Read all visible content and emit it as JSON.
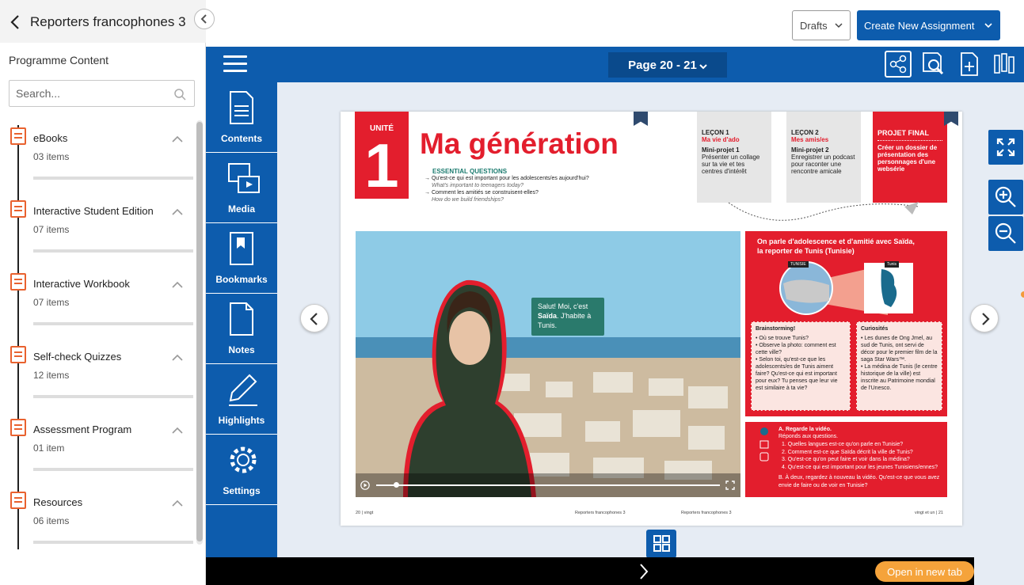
{
  "sidebar": {
    "book_title": "Reporters francophones 3",
    "programme_label": "Programme Content",
    "search_placeholder": "Search...",
    "sections": [
      {
        "name": "eBooks",
        "count": "03 items"
      },
      {
        "name": "Interactive Student Edition",
        "count": "07 items"
      },
      {
        "name": "Interactive Workbook",
        "count": "07 items"
      },
      {
        "name": "Self-check Quizzes",
        "count": "12 items"
      },
      {
        "name": "Assessment Program",
        "count": "01 item"
      },
      {
        "name": "Resources",
        "count": "06 items"
      }
    ]
  },
  "header": {
    "drafts_label": "Drafts",
    "create_label": "Create New Assignment"
  },
  "viewer": {
    "page_selector": "Page 20 - 21",
    "rail": [
      {
        "label": "Contents",
        "icon": "contents-icon"
      },
      {
        "label": "Media",
        "icon": "media-icon"
      },
      {
        "label": "Bookmarks",
        "icon": "bookmark-icon"
      },
      {
        "label": "Notes",
        "icon": "notes-icon"
      },
      {
        "label": "Highlights",
        "icon": "highlight-icon"
      },
      {
        "label": "Settings",
        "icon": "gear-icon"
      }
    ],
    "open_new_tab": "Open in new tab",
    "accent_color": "#0d5cad"
  },
  "page": {
    "unit_label": "UNITÉ",
    "unit_number": "1",
    "title": "Ma génération",
    "essential_questions_title": "ESSENTIAL QUESTIONS",
    "q1": "Qu'est-ce qui est important pour les adolescents/es aujourd'hui?",
    "q1_en": "What's important to teenagers today?",
    "q2": "Comment les amitiés se construisent-elles?",
    "q2_en": "How do we build friendships?",
    "lecon1": {
      "head": "LEÇON 1",
      "sub": "Ma vie d'ado",
      "proj": "Mini-projet 1",
      "desc": "Présenter un collage sur ta vie et tes centres d'intérêt"
    },
    "lecon2": {
      "head": "LEÇON 2",
      "sub": "Mes amis/es",
      "proj": "Mini-projet 2",
      "desc": "Enregistrer un podcast pour raconter une rencontre amicale"
    },
    "projet": {
      "head": "PROJET FINAL",
      "desc": "Créer un dossier de présentation des personnages d'une websérie"
    },
    "bubble_1": "Salut! Moi, c'est",
    "bubble_name": "Saïda",
    "bubble_2": ". J'habite à Tunis.",
    "red_heading_1": "On parle d'adolescence et d'amitié avec Saïda,",
    "red_heading_2": "la reporter de ",
    "red_heading_place": "Tunis (Tunisie)",
    "map_label_1": "TUNISIE",
    "map_label_2": "Tunis",
    "brainstorm_title": "Brainstorming!",
    "brainstorm_items": [
      "• Où se trouve Tunis?",
      "• Observe la photo: comment est cette ville?",
      "• Selon toi, qu'est-ce que les adolescents/es de Tunis aiment faire? Qu'est-ce qui est important pour eux? Tu penses que leur vie est similaire à ta vie?"
    ],
    "curio_title": "Curiosités",
    "curio_items": [
      "• Les dunes de Ong Jmel, au sud de Tunis, ont servi de décor pour le premier film de la saga Star Wars™.",
      "• La médina de Tunis (le centre historique de la ville) est inscrite au Patrimoine mondial de l'Unesco."
    ],
    "task_a": "A. Regarde la vidéo.",
    "task_a2": "Réponds aux questions.",
    "task_q": [
      "1. Quelles langues est-ce qu'on parle en Tunisie?",
      "2. Comment est-ce que Saïda décrit la ville de Tunis?",
      "3. Qu'est-ce qu'on peut faire et voir dans la médina?",
      "4. Qu'est-ce qui est important pour les jeunes Tunisiens/ennes?"
    ],
    "task_b": "B. À deux, regardez à nouveau la vidéo. Qu'est-ce que vous avez envie de faire ou de voir en Tunisie?",
    "foot_left": "20 | vingt",
    "foot_mid1": "Reporters francophones 3",
    "foot_mid2": "Reporters francophones 3",
    "foot_right": "vingt et un | 21"
  }
}
